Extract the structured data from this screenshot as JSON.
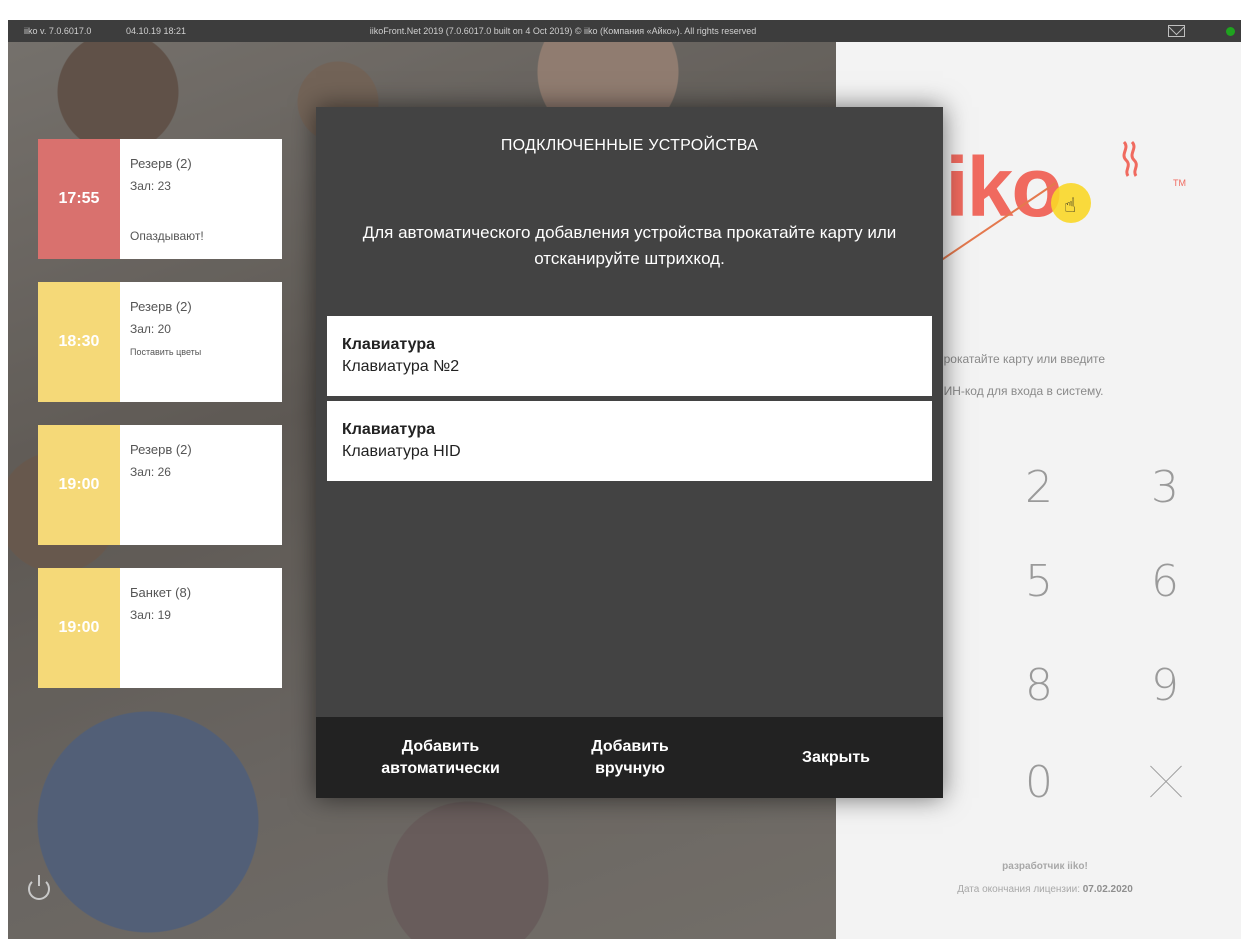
{
  "topbar": {
    "version": "iiko v. 7.0.6017.0",
    "datetime": "04.10.19  18:21",
    "build_info": "iikoFront.Net 2019 (7.0.6017.0 built on 4 Oct 2019) © iiko (Компания «Айко»). All rights reserved",
    "mail_icon": "envelope-icon",
    "status_color": "#1fa31f"
  },
  "reservations": [
    {
      "time": "17:55",
      "title": "Резерв (2)",
      "hall": "Зал: 23",
      "note": "Опаздывают!",
      "color": "#d9716e"
    },
    {
      "time": "18:30",
      "title": "Резерв (2)",
      "hall": "Зал: 20",
      "note": "Поставить цветы",
      "color": "#f5d978"
    },
    {
      "time": "19:00",
      "title": "Резерв (2)",
      "hall": "Зал: 26",
      "note": "",
      "color": "#f5d978"
    },
    {
      "time": "19:00",
      "title": "Банкет (8)",
      "hall": "Зал: 19",
      "note": "",
      "color": "#f5d978"
    }
  ],
  "login": {
    "logo": "iiko",
    "trademark": "TM",
    "hint_line1": "Прокатайте карту или введите",
    "hint_line2": "ПИН-код для входа в систему.",
    "keys": [
      "2",
      "3",
      "5",
      "6",
      "8",
      "9",
      "0"
    ],
    "developer": "разработчик iiko!",
    "license_label": "Дата окончания лицензии: ",
    "license_date": "07.02.2020",
    "accent_color": "#f06a5f"
  },
  "modal": {
    "title": "ПОДКЛЮЧЕННЫЕ УСТРОЙСТВА",
    "instruction": "Для автоматического добавления устройства прокатайте карту или отсканируйте штрихкод.",
    "devices": [
      {
        "type": "Клавиатура",
        "name": "Клавиатура №2"
      },
      {
        "type": "Клавиатура",
        "name": "Клавиатура HID"
      }
    ],
    "buttons": {
      "auto_line1": "Добавить",
      "auto_line2": "автоматически",
      "manual_line1": "Добавить",
      "manual_line2": "вручную",
      "close": "Закрыть"
    }
  }
}
